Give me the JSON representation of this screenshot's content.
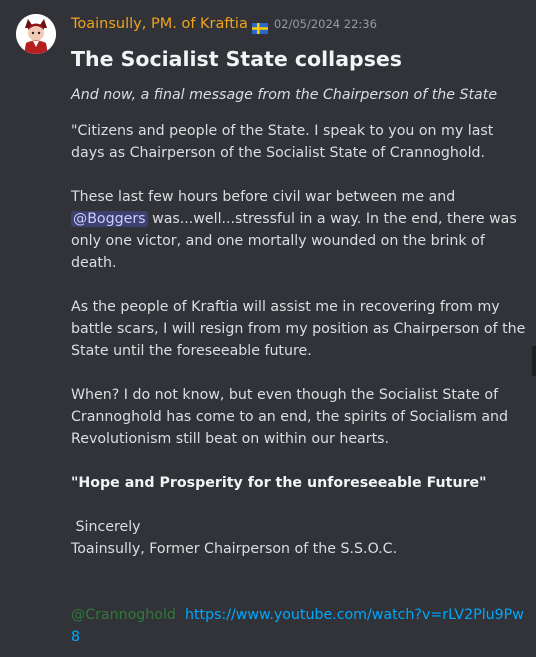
{
  "author": {
    "username": "Toainsully, PM. of Kraftia",
    "flag": "sweden-flag-icon",
    "timestamp": "02/05/2024 22:36"
  },
  "message": {
    "title": "The Socialist State collapses",
    "subtitle": "And now, a final message from the Chairperson of the State",
    "paragraph1": "\"Citizens and people of the State. I speak to you on my last days as Chairperson of the Socialist State of Crannoghold.",
    "paragraph2_before": "These last few hours before civil war between me and ",
    "mention_user": "@Boggers",
    "paragraph2_after": " was...well...stressful in a way. In the end, there was only one victor, and one mortally wounded on the brink of death.",
    "paragraph3": "As the people of Kraftia will assist me in recovering from my battle scars, I will resign from my position as Chairperson of the State until the foreseeable future.",
    "paragraph4": "When? I do not know, but even though the Socialist State of Crannoghold has come to an end, the spirits of Socialism and Revolutionism still beat on within our hearts.",
    "motto": "\"Hope and Prosperity for the unforeseeable Future\"",
    "signoff": " Sincerely",
    "signature": "Toainsully, Former Chairperson of the S.S.O.C.",
    "mention_role": "@Crannoghold",
    "link": "https://www.youtube.com/watch?v=rLV2Plu9Pw8"
  },
  "colors": {
    "background": "#313338",
    "username": "#f0a31c",
    "link": "#00a8fc",
    "role_mention": "#2f7a38"
  }
}
